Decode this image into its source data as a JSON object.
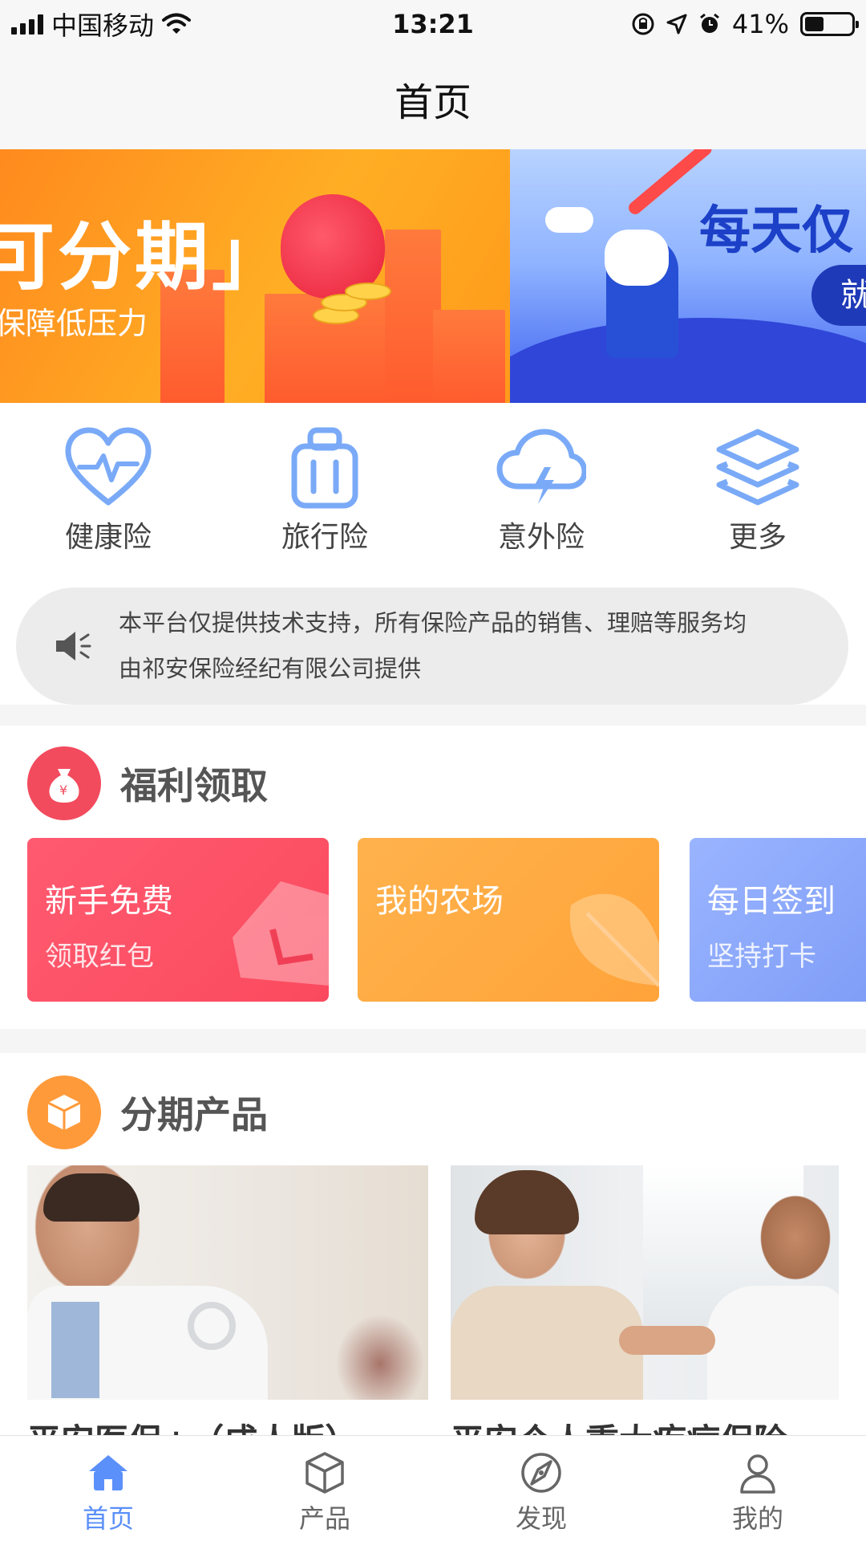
{
  "status_bar": {
    "carrier": "中国移动",
    "time": "13:21",
    "battery": "41%",
    "battery_level": 0.41
  },
  "nav": {
    "title": "首页"
  },
  "banner": {
    "slides": [
      {
        "title": "可分期」",
        "subtitle": "保障低压力"
      },
      {
        "title": "每天仅",
        "button": "就"
      }
    ]
  },
  "categories": [
    {
      "label": "健康险",
      "icon": "heart-pulse-icon"
    },
    {
      "label": "旅行险",
      "icon": "luggage-icon"
    },
    {
      "label": "意外险",
      "icon": "cloud-lightning-icon"
    },
    {
      "label": "更多",
      "icon": "layers-icon"
    }
  ],
  "notice": {
    "icon": "speaker-icon",
    "text_line1": "本平台仅提供技术支持，所有保险产品的销售、理赔等服务均",
    "text_line2": "由祁安保险经纪有限公司提供"
  },
  "welfare": {
    "title": "福利领取",
    "cards": [
      {
        "title": "新手免费",
        "subtitle": "领取红包",
        "color": "#fb5268"
      },
      {
        "title": "我的农场",
        "subtitle": "",
        "color": "#ffaa40"
      },
      {
        "title": "每日签到",
        "subtitle": "坚持打卡",
        "color": "#8aa8ff"
      }
    ]
  },
  "products": {
    "title": "分期产品",
    "items": [
      {
        "title": "平安医保+（成人版）"
      },
      {
        "title": "平安个人重大疾病保险"
      }
    ]
  },
  "tabbar": {
    "tabs": [
      {
        "label": "首页",
        "icon": "home-icon",
        "active": true
      },
      {
        "label": "产品",
        "icon": "box-icon",
        "active": false
      },
      {
        "label": "发现",
        "icon": "compass-icon",
        "active": false
      },
      {
        "label": "我的",
        "icon": "user-icon",
        "active": false
      }
    ]
  },
  "colors": {
    "accent": "#5b8ff9",
    "icon_blue": "#7aaaf7",
    "welfare_badge": "#f24b5e",
    "product_badge": "#ff9a3a"
  }
}
